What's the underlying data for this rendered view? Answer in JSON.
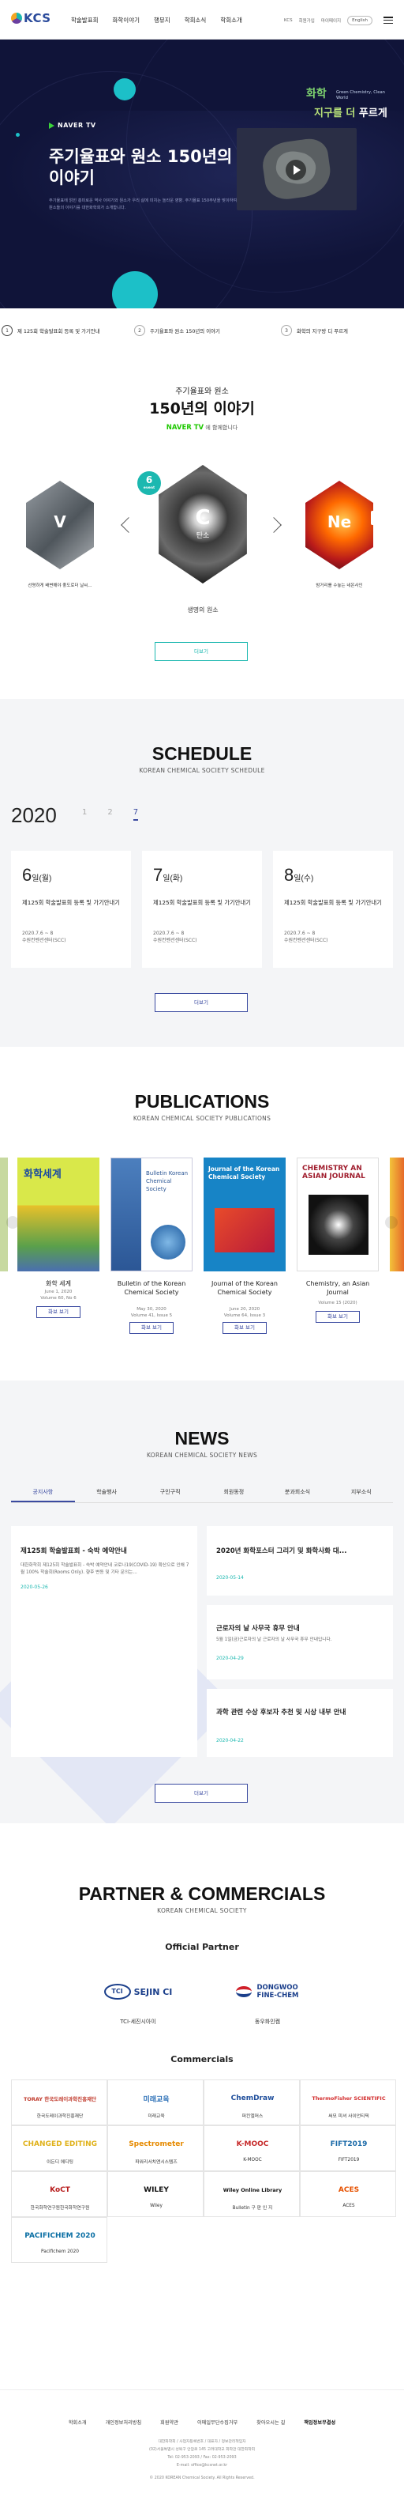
{
  "header": {
    "logo_text": "KCS",
    "nav": [
      "학술발표회",
      "화학이야기",
      "행뮤지",
      "학회소식",
      "학회소개"
    ],
    "util": [
      "KCS",
      "회원가입",
      "마이페이지"
    ],
    "lang": "English"
  },
  "hero": {
    "badge_main": "화학",
    "badge_sub": "Green Chemistry, Clean World",
    "badge_line2_a": "지구를 더",
    "badge_line2_b": "푸르게",
    "naver_label": "NAVER TV",
    "title": "주기율표와 원소 150년의 이야기",
    "desc": "주기율표에 얽힌 흥미로운 역사 이야기와 원소가 우리 삶에 미치는 놀라운 영향. 주기율표 150주년을 맞이하여 원소들의 이야기를 대한화학회가 소개합니다.",
    "tabs": [
      {
        "num": "1",
        "label": "제 125회 학술발표회 등록 및 가기안내"
      },
      {
        "num": "2",
        "label": "주기율표와 원소 150년의 이야기"
      },
      {
        "num": "3",
        "label": "화학의 지구방 디 푸르게"
      }
    ]
  },
  "elements": {
    "small_title": "주기율표와 원소",
    "big_title": "150년의 이야기",
    "naver_label": "NAVER TV",
    "naver_suffix": "에 함께합니다",
    "badge_num": "6",
    "badge_label": "event",
    "items": [
      {
        "sym": "V",
        "name": "",
        "caption": "선명하게 배변해야 좋도로더 날씨..."
      },
      {
        "sym": "C",
        "name": "탄소",
        "caption": "생명의 원소"
      },
      {
        "sym": "Ne",
        "name": "",
        "caption": "밤거리를 수놓는 네온사인"
      }
    ],
    "more_button": "더보기"
  },
  "schedule": {
    "title": "SCHEDULE",
    "subtitle": "KOREAN CHEMICAL SOCIETY SCHEDULE",
    "year": "2020",
    "months": [
      "1",
      "2",
      "7"
    ],
    "cards": [
      {
        "day": "6",
        "dow": "일(월)",
        "title": "제125회 학술발표회 등록 및 가기안내기",
        "date": "2020.7.6 ~ 8",
        "place": "수원컨벤션센터(SCC)"
      },
      {
        "day": "7",
        "dow": "일(화)",
        "title": "제125회 학술발표회 등록 및 가기안내기",
        "date": "2020.7.6 ~ 8",
        "place": "수원컨벤션센터(SCC)"
      },
      {
        "day": "8",
        "dow": "일(수)",
        "title": "제125회 학술발표회 등록 및 가기안내기",
        "date": "2020.7.6 ~ 8",
        "place": "수원컨벤션센터(SCC)"
      }
    ],
    "more_button": "더보기"
  },
  "publications": {
    "title": "PUBLICATIONS",
    "subtitle": "KOREAN CHEMICAL SOCIETY PUBLICATIONS",
    "items": [
      {
        "name": "화학 세계",
        "meta1": "June 1, 2020",
        "meta2": "Volume 60, No 6",
        "cover_text": "화학세계",
        "button": "화보 보기",
        "color": "#d9e84a"
      },
      {
        "name": "Bulletin of the Korean Chemical Society",
        "meta1": "May 30, 2020",
        "meta2": "Volume 41, Issue 5",
        "cover_text": "Bulletin Korean Chemical Society",
        "button": "화보 보기",
        "color": "#ffffff"
      },
      {
        "name": "Journal of the Korean Chemical Society",
        "meta1": "June 20, 2020",
        "meta2": "Volume 64, Issue 3",
        "cover_text": "Journal of the Korean Chemical Society",
        "button": "화보 보기",
        "color": "#1784c6"
      },
      {
        "name": "Chemistry, an Asian Journal",
        "meta1": "Volume 15 (2020)",
        "meta2": "",
        "cover_text": "CHEMISTRY AN ASIAN JOURNAL",
        "button": "화보 보기",
        "color": "#ffffff"
      }
    ]
  },
  "news": {
    "title": "NEWS",
    "subtitle": "KOREAN CHEMICAL SOCIETY NEWS",
    "tabs": [
      "공지사항",
      "학술행사",
      "구인구직",
      "회원동정",
      "분과회소식",
      "지부소식"
    ],
    "main": {
      "title": "제125회 학술발표회 - 숙박 예약안내",
      "text": "대한화학회 제125회 학술발표회 - 숙박 예약안내 코로나19(COVID-19) 확산으로 인해 7월 100% 학술회(Rooms Only). 향후 변동 및 기타 문의는...",
      "date": "2020-05-26"
    },
    "side": [
      {
        "title": "2020년 화학포스터 그리기 및 화학사화 대...",
        "text": "",
        "date": "2020-05-14"
      },
      {
        "title": "근로자의 날 사무국 휴무 안내",
        "text": "5월 1일(금)근로자의 날 근로자의 날 사무국 휴무 안내입니다.",
        "date": "2020-04-29"
      },
      {
        "title": "과학 관련 수상 후보자 추천 및 시상 내부 안내",
        "text": "",
        "date": "2020-04-22"
      }
    ],
    "more_button": "더보기"
  },
  "partners": {
    "title": "PARTNER & COMMERCIALS",
    "subtitle": "KOREAN CHEMICAL SOCIETY",
    "official_title": "Official Partner",
    "official": [
      {
        "logo": "TCI SEJIN CI",
        "caption": "TCI-세진시아이"
      },
      {
        "logo": "DONGWOO FINE-CHEM",
        "caption": "동우화인켐"
      }
    ],
    "commercials_title": "Commercials",
    "commercials": [
      {
        "logo": "TORAY 한국도레이과학진흥재단",
        "caption": "한국도레이과학진흥재단",
        "color": "#c0392b"
      },
      {
        "logo": "미래교육",
        "caption": "미래교육",
        "color": "#2b6fb6"
      },
      {
        "logo": "ChemDraw",
        "caption": "퍼킨엘머스",
        "color": "#1f4e9b"
      },
      {
        "logo": "ThermoFisher SCIENTIFIC",
        "caption": "써모 피셔 사이언티픽",
        "color": "#d32f2f"
      },
      {
        "logo": "CHANGED EDITING",
        "caption": "이든디 에디팅",
        "color": "#e0b21b"
      },
      {
        "logo": "Spectrometer",
        "caption": "파워리서치앤시스템즈",
        "color": "#e68a00"
      },
      {
        "logo": "K-MOOC",
        "caption": "K-MOOC",
        "color": "#c62828"
      },
      {
        "logo": "FIFT2019",
        "caption": "FIFT2019",
        "color": "#1a6aa8"
      },
      {
        "logo": "KoCT",
        "caption": "한국화학연구원한국화학연구원",
        "color": "#b71c1c"
      },
      {
        "logo": "WILEY",
        "caption": "Wiley",
        "color": "#111111"
      },
      {
        "logo": "Wiley Online Library",
        "caption": "Bulletin 구 판 인 지",
        "color": "#111111"
      },
      {
        "logo": "ACES",
        "caption": "ACES",
        "color": "#e65100"
      },
      {
        "logo": "PACIFICHEM 2020",
        "caption": "Pacifichem 2020",
        "color": "#0b6fa4"
      }
    ]
  },
  "footer": {
    "nav": [
      "학회소개",
      "개인정보처리방침",
      "회원약관",
      "이메일무단수집거부",
      "찾아오시는 길",
      "책임정보무결성"
    ],
    "info": [
      "대한화학회 / 사업자등록번호 / 대표자 / 정보관리책임자",
      "(02)서울특별시 성북구 안암로 145 고려대학교 화학관 대한화학회",
      "Tel: 02-953-2093 / Fax: 02-953-2093",
      "E-mail: office@kcsnet.or.kr",
      "© 2020 KOREAN Chemical Society. All Rights Reserved."
    ]
  }
}
